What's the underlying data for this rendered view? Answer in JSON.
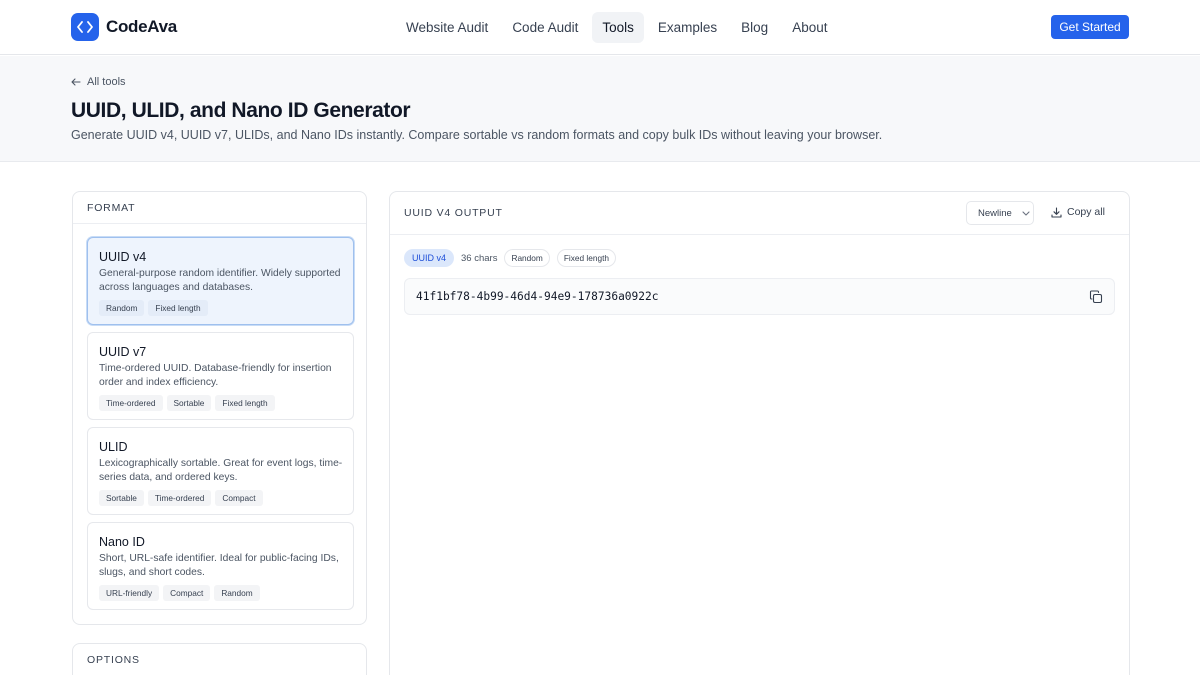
{
  "brand": {
    "name": "CodeAva",
    "accent": "#2563eb"
  },
  "nav": {
    "items": [
      {
        "label": "Website Audit",
        "active": false
      },
      {
        "label": "Code Audit",
        "active": false
      },
      {
        "label": "Tools",
        "active": true
      },
      {
        "label": "Examples",
        "active": false
      },
      {
        "label": "Blog",
        "active": false
      },
      {
        "label": "About",
        "active": false
      }
    ],
    "cta": "Get Started"
  },
  "hero": {
    "back_label": "All tools",
    "title": "UUID, ULID, and Nano ID Generator",
    "subtitle": "Generate UUID v4, UUID v7, ULIDs, and Nano IDs instantly. Compare sortable vs random formats and copy bulk IDs without leaving your browser."
  },
  "format": {
    "heading": "FORMAT",
    "options": [
      {
        "title": "UUID v4",
        "desc": "General-purpose random identifier. Widely supported across languages and databases.",
        "tags": [
          "Random",
          "Fixed length"
        ],
        "selected": true
      },
      {
        "title": "UUID v7",
        "desc": "Time-ordered UUID. Database-friendly for insertion order and index efficiency.",
        "tags": [
          "Time-ordered",
          "Sortable",
          "Fixed length"
        ],
        "selected": false
      },
      {
        "title": "ULID",
        "desc": "Lexicographically sortable. Great for event logs, time-series data, and ordered keys.",
        "tags": [
          "Sortable",
          "Time-ordered",
          "Compact"
        ],
        "selected": false
      },
      {
        "title": "Nano ID",
        "desc": "Short, URL-safe identifier. Ideal for public-facing IDs, slugs, and short codes.",
        "tags": [
          "URL-friendly",
          "Compact",
          "Random"
        ],
        "selected": false
      }
    ]
  },
  "options_panel": {
    "heading": "OPTIONS"
  },
  "output": {
    "heading": "UUID V4 OUTPUT",
    "separator": "Newline",
    "copy_all": "Copy all",
    "badge": "UUID v4",
    "chars": "36 chars",
    "pills": [
      "Random",
      "Fixed length"
    ],
    "values": [
      "41f1bf78-4b99-46d4-94e9-178736a0922c"
    ]
  }
}
